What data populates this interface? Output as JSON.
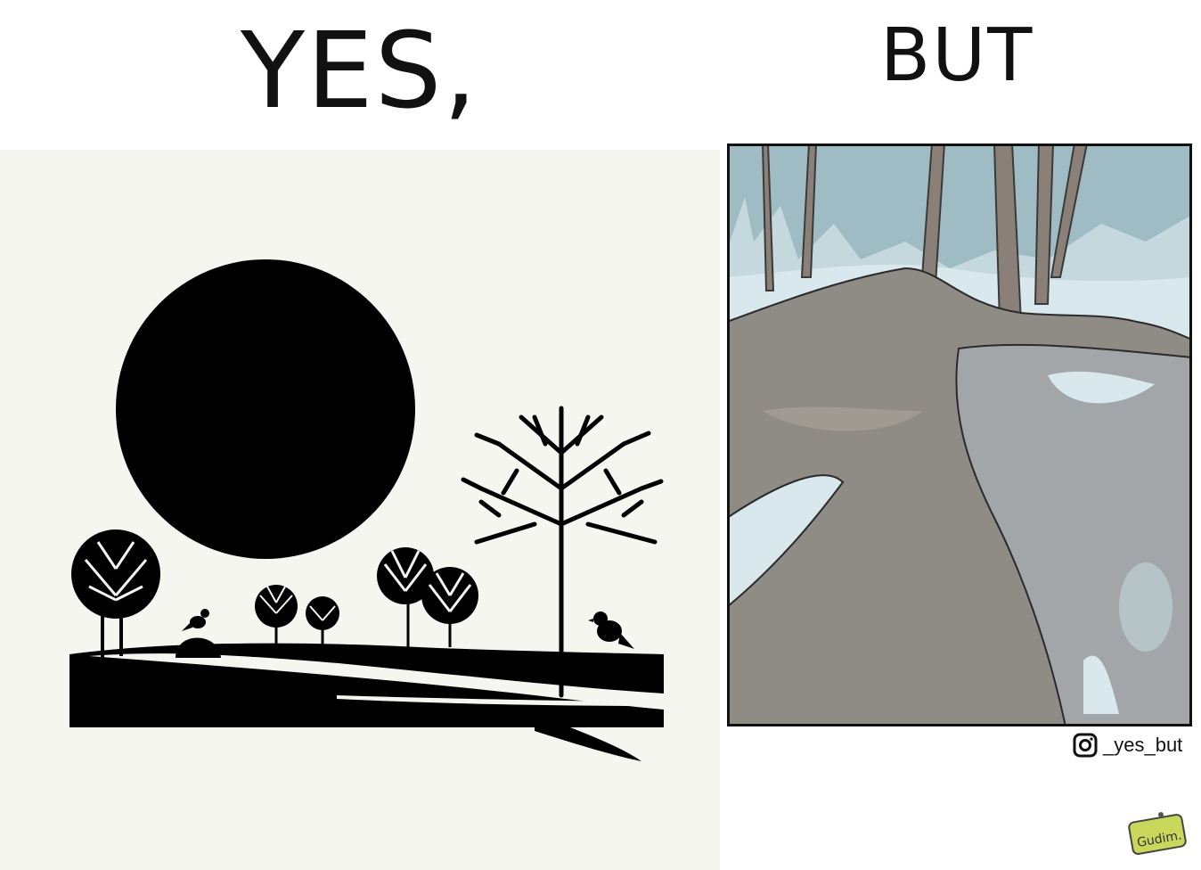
{
  "left": {
    "heading": "YES,"
  },
  "right": {
    "heading": "BUT"
  },
  "watermark": {
    "handle": "_yes_but",
    "icon": "instagram-icon"
  },
  "signature": {
    "text": "Gudim."
  },
  "colors": {
    "ink": "#111111",
    "paper": "#f6f6f0",
    "sky": "#9ab8c2",
    "snow": "#d7e7ec",
    "mud": "#8f8c86"
  }
}
